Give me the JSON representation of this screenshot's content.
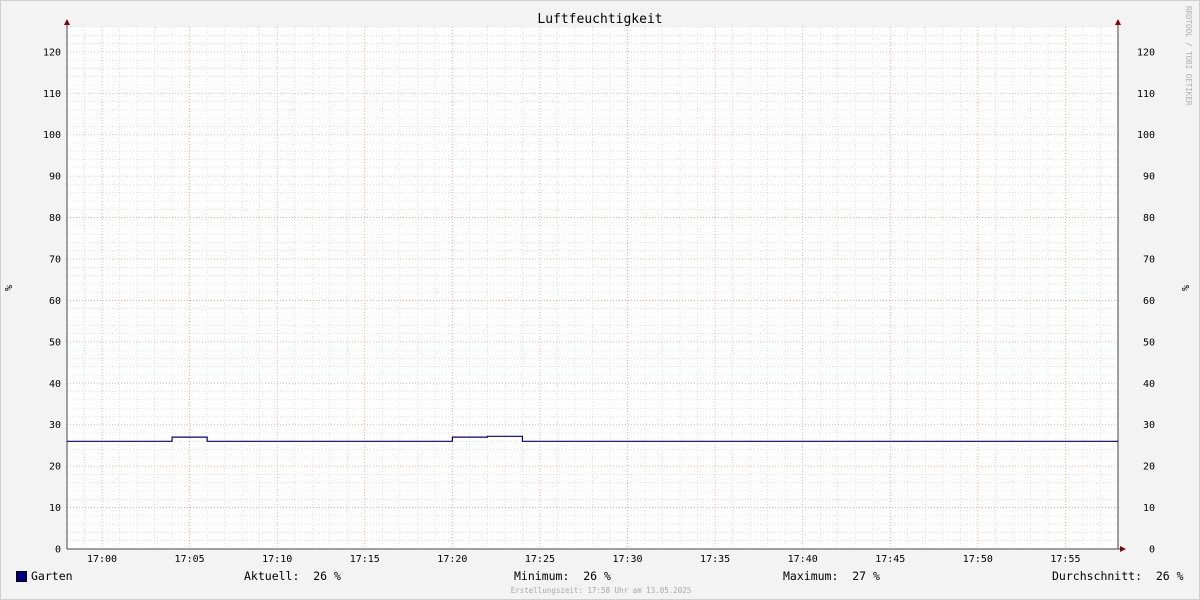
{
  "chart_data": {
    "type": "line",
    "title": "Luftfeuchtigkeit",
    "ylabel": "%",
    "ylabel_right": "%",
    "ylim": [
      0,
      126
    ],
    "y_ticks": [
      0,
      10,
      20,
      30,
      40,
      50,
      60,
      70,
      80,
      90,
      100,
      110,
      120
    ],
    "x_ticks": [
      "17:00",
      "17:05",
      "17:10",
      "17:15",
      "17:20",
      "17:25",
      "17:30",
      "17:35",
      "17:40",
      "17:45",
      "17:50",
      "17:55"
    ],
    "x_start": "16:58",
    "x_end": "17:58",
    "grid": true,
    "series": [
      {
        "name": "Garten",
        "color": "#000080",
        "points": [
          [
            "16:58",
            26
          ],
          [
            "17:04",
            26
          ],
          [
            "17:04",
            27
          ],
          [
            "17:06",
            27
          ],
          [
            "17:06",
            26
          ],
          [
            "17:20",
            26
          ],
          [
            "17:20",
            27
          ],
          [
            "17:22",
            27
          ],
          [
            "17:22",
            27.2
          ],
          [
            "17:24",
            27.2
          ],
          [
            "17:24",
            26
          ],
          [
            "17:58",
            26
          ]
        ]
      }
    ],
    "watermark": "RRDTOOL / TOBI OETIKER"
  },
  "legend": {
    "series_name": "Garten",
    "swatch_color": "#000080",
    "current": "Aktuell:  26 %",
    "minimum": "Minimum:  26 %",
    "maximum": "Maximum:  27 %",
    "average": "Durchschnitt:  26 %"
  },
  "footer": "Erstellungszeit: 17:58 Uhr am 13.05.2025",
  "colors": {
    "background": "#f3f3f3",
    "plot_background": "#ffffff",
    "major_grid": "#e8a0a0",
    "minor_grid": "#cfcfcf"
  }
}
